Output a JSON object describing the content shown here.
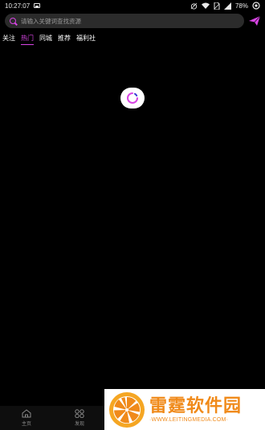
{
  "status_bar": {
    "time": "10:27:07",
    "battery": "78%",
    "icons": [
      "image-icon",
      "alarm-icon",
      "wifi-icon",
      "no-sim-icon",
      "signal-icon",
      "eye-icon"
    ]
  },
  "search": {
    "placeholder": "请输入关键词查找资源",
    "value": "",
    "search_icon": "search-icon",
    "send_icon": "send-icon"
  },
  "tabs": [
    {
      "label": "关注",
      "active": false
    },
    {
      "label": "热门",
      "active": true
    },
    {
      "label": "同城",
      "active": false
    },
    {
      "label": "推荐",
      "active": false
    },
    {
      "label": "福利社",
      "active": false
    }
  ],
  "loader": {
    "icon": "loading-spinner-icon"
  },
  "bottom_nav": [
    {
      "label": "主页",
      "icon": "home-icon"
    },
    {
      "label": "发现",
      "icon": "discover-icon"
    }
  ],
  "watermark": {
    "title": "雷霆软件园",
    "url": "WWW.LEITINGMEDIA.COM"
  },
  "colors": {
    "background": "#000000",
    "accent": "#d845e4",
    "search_bg": "#2b2b2b",
    "watermark_orange": "#f08a1a"
  }
}
